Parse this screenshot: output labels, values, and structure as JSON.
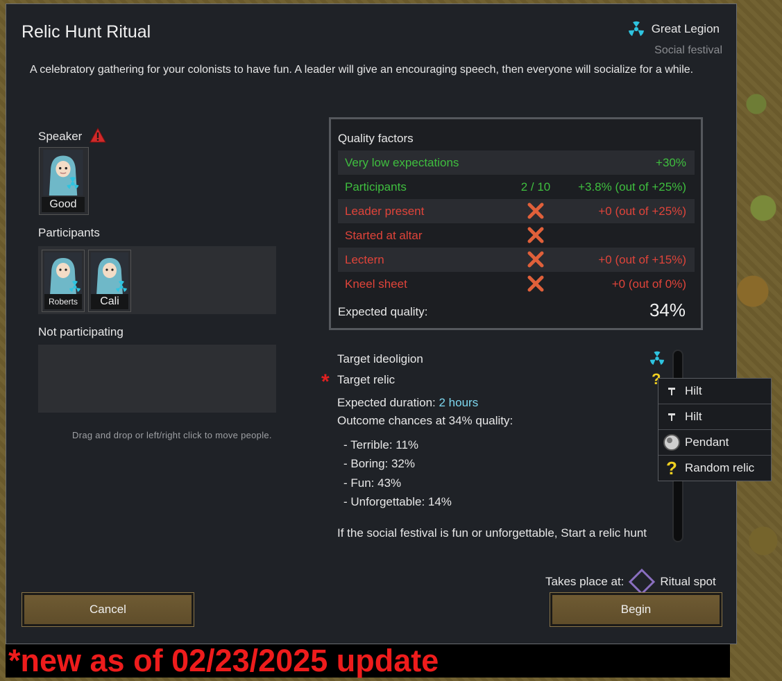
{
  "dialog": {
    "title": "Relic Hunt Ritual",
    "ideoligion_name": "Great Legion",
    "ritual_type": "Social festival",
    "description": "A celebratory gathering for your colonists to have fun. A leader will give an encouraging speech, then everyone will socialize for a while."
  },
  "speaker": {
    "label": "Speaker",
    "warning_icon": "warning-triangle-icon",
    "pawn_name": "Good"
  },
  "participants": {
    "label": "Participants",
    "pawns": [
      "Roberts",
      "Cali"
    ]
  },
  "not_participating": {
    "label": "Not participating"
  },
  "hint": "Drag and drop or left/right click to move people.",
  "quality": {
    "title": "Quality factors",
    "rows": [
      {
        "label": "Very low expectations",
        "mid": "",
        "value": "+30%",
        "status": "positive"
      },
      {
        "label": "Participants",
        "mid": "2 / 10",
        "value": "+3.8% (out of +25%)",
        "status": "positive"
      },
      {
        "label": "Leader present",
        "mid": "x",
        "value": "+0 (out of +25%)",
        "status": "negative"
      },
      {
        "label": "Started at altar",
        "mid": "x",
        "value": "",
        "status": "negative"
      },
      {
        "label": "Lectern",
        "mid": "x",
        "value": "+0 (out of +15%)",
        "status": "negative"
      },
      {
        "label": "Kneel sheet",
        "mid": "x",
        "value": "+0 (out of 0%)",
        "status": "negative"
      }
    ],
    "expected_label": "Expected quality:",
    "expected_value": "34%"
  },
  "target": {
    "ideoligion_label": "Target ideoligion",
    "relic_label": "Target relic",
    "required_marker": "*"
  },
  "duration": {
    "label": "Expected duration:",
    "value": "2 hours"
  },
  "outcomes": {
    "label": "Outcome chances at 34% quality:",
    "items": [
      "- Terrible: 11%",
      "- Boring: 32%",
      "- Fun: 43%",
      "- Unforgettable: 14%"
    ],
    "footer": "If the social festival is fun or unforgettable, Start a relic hunt"
  },
  "relic_dropdown": {
    "items": [
      {
        "label": "Hilt",
        "icon": "hilt-icon"
      },
      {
        "label": "Hilt",
        "icon": "hilt-icon"
      },
      {
        "label": "Pendant",
        "icon": "pendant-icon"
      },
      {
        "label": "Random relic",
        "icon": "question-mark-icon"
      }
    ]
  },
  "location": {
    "label": "Takes place at:",
    "value": "Ritual spot"
  },
  "buttons": {
    "cancel": "Cancel",
    "begin": "Begin"
  },
  "banner": "*new as of 02/23/2025 update",
  "colors": {
    "positive": "#3fbf3f",
    "negative": "#e0443a",
    "accent_cyan": "#7ed8f0",
    "banner_red": "#ee1c1c",
    "button": "#6f5b33"
  }
}
